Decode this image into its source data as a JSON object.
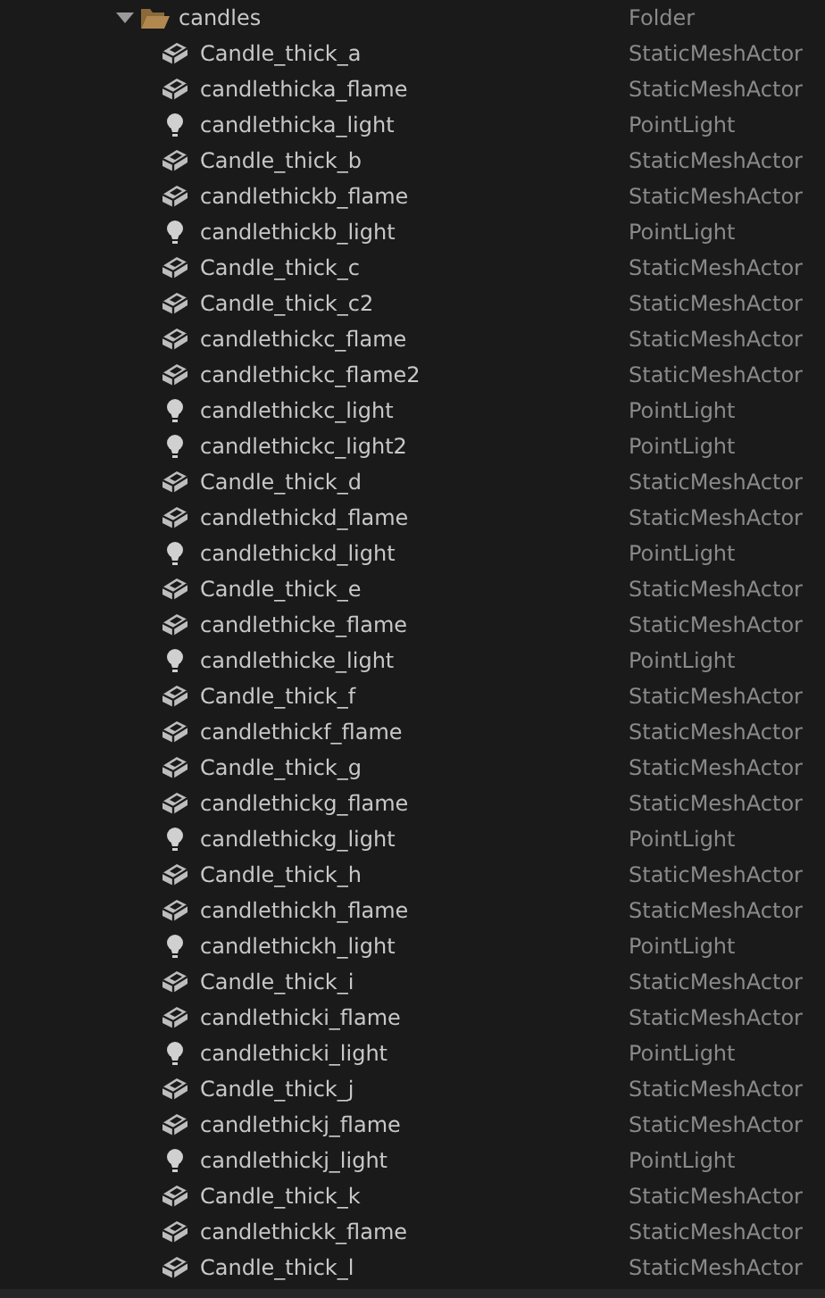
{
  "tree": [
    {
      "label": "candles",
      "type": "Folder",
      "kind": "folder",
      "expanded": true,
      "children": [
        {
          "label": "Candle_thick_a",
          "type": "StaticMeshActor",
          "kind": "mesh"
        },
        {
          "label": "candlethicka_flame",
          "type": "StaticMeshActor",
          "kind": "mesh"
        },
        {
          "label": "candlethicka_light",
          "type": "PointLight",
          "kind": "light"
        },
        {
          "label": "Candle_thick_b",
          "type": "StaticMeshActor",
          "kind": "mesh"
        },
        {
          "label": "candlethickb_flame",
          "type": "StaticMeshActor",
          "kind": "mesh"
        },
        {
          "label": "candlethickb_light",
          "type": "PointLight",
          "kind": "light"
        },
        {
          "label": "Candle_thick_c",
          "type": "StaticMeshActor",
          "kind": "mesh"
        },
        {
          "label": "Candle_thick_c2",
          "type": "StaticMeshActor",
          "kind": "mesh"
        },
        {
          "label": "candlethickc_flame",
          "type": "StaticMeshActor",
          "kind": "mesh"
        },
        {
          "label": "candlethickc_flame2",
          "type": "StaticMeshActor",
          "kind": "mesh"
        },
        {
          "label": "candlethickc_light",
          "type": "PointLight",
          "kind": "light"
        },
        {
          "label": "candlethickc_light2",
          "type": "PointLight",
          "kind": "light"
        },
        {
          "label": "Candle_thick_d",
          "type": "StaticMeshActor",
          "kind": "mesh"
        },
        {
          "label": "candlethickd_flame",
          "type": "StaticMeshActor",
          "kind": "mesh"
        },
        {
          "label": "candlethickd_light",
          "type": "PointLight",
          "kind": "light"
        },
        {
          "label": "Candle_thick_e",
          "type": "StaticMeshActor",
          "kind": "mesh"
        },
        {
          "label": "candlethicke_flame",
          "type": "StaticMeshActor",
          "kind": "mesh"
        },
        {
          "label": "candlethicke_light",
          "type": "PointLight",
          "kind": "light"
        },
        {
          "label": "Candle_thick_f",
          "type": "StaticMeshActor",
          "kind": "mesh"
        },
        {
          "label": "candlethickf_flame",
          "type": "StaticMeshActor",
          "kind": "mesh"
        },
        {
          "label": "Candle_thick_g",
          "type": "StaticMeshActor",
          "kind": "mesh"
        },
        {
          "label": "candlethickg_flame",
          "type": "StaticMeshActor",
          "kind": "mesh"
        },
        {
          "label": "candlethickg_light",
          "type": "PointLight",
          "kind": "light"
        },
        {
          "label": "Candle_thick_h",
          "type": "StaticMeshActor",
          "kind": "mesh"
        },
        {
          "label": "candlethickh_flame",
          "type": "StaticMeshActor",
          "kind": "mesh"
        },
        {
          "label": "candlethickh_light",
          "type": "PointLight",
          "kind": "light"
        },
        {
          "label": "Candle_thick_i",
          "type": "StaticMeshActor",
          "kind": "mesh"
        },
        {
          "label": "candlethicki_flame",
          "type": "StaticMeshActor",
          "kind": "mesh"
        },
        {
          "label": "candlethicki_light",
          "type": "PointLight",
          "kind": "light"
        },
        {
          "label": "Candle_thick_j",
          "type": "StaticMeshActor",
          "kind": "mesh"
        },
        {
          "label": "candlethickj_flame",
          "type": "StaticMeshActor",
          "kind": "mesh"
        },
        {
          "label": "candlethickj_light",
          "type": "PointLight",
          "kind": "light"
        },
        {
          "label": "Candle_thick_k",
          "type": "StaticMeshActor",
          "kind": "mesh"
        },
        {
          "label": "candlethickk_flame",
          "type": "StaticMeshActor",
          "kind": "mesh"
        },
        {
          "label": "Candle_thick_l",
          "type": "StaticMeshActor",
          "kind": "mesh"
        }
      ]
    }
  ]
}
